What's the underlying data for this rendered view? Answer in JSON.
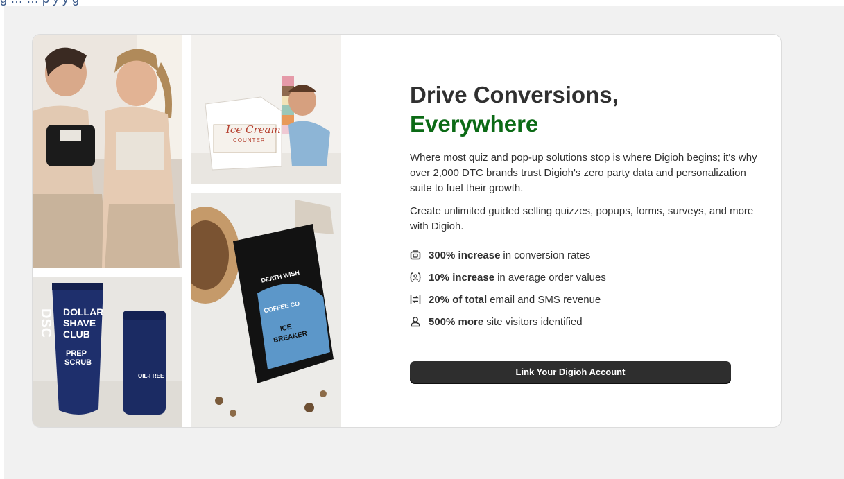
{
  "banner": {
    "text": "g … … p y y g"
  },
  "hero": {
    "title_line1": "Drive Conversions,",
    "title_line2": "Everywhere",
    "paragraph1": "Where most quiz and pop-up solutions stop is where Digioh begins; it's why over 2,000 DTC brands trust Digioh's zero party data and personalization suite to fuel their growth.",
    "paragraph2": "Create unlimited guided selling quizzes, popups, forms, surveys, and more with Digioh.",
    "stats": [
      {
        "icon": "conversion-icon",
        "value": "300% increase",
        "label": "in conversion rates"
      },
      {
        "icon": "order-value-icon",
        "value": "10% increase",
        "label": "in average order values"
      },
      {
        "icon": "revenue-icon",
        "value": "20% of total",
        "label": "email and SMS revenue"
      },
      {
        "icon": "user-icon",
        "value": "500% more",
        "label": "site visitors identified"
      }
    ],
    "cta_label": "Link Your Digioh Account"
  },
  "images": {
    "fitness": {
      "label": ""
    },
    "toy": {
      "label": "Ice Cream",
      "sublabel": "COUNTER"
    },
    "shave": {
      "brand_short": "DSC",
      "brand_line1": "DOLLAR",
      "brand_line2": "SHAVE",
      "brand_line3": "CLUB",
      "product1_line1": "PREP",
      "product1_line2": "SCRUB",
      "product2_line1": "OIL-FREE"
    },
    "coffee": {
      "brand_line1": "DEATH WISH",
      "brand_line2": "COFFEE CO",
      "product_line1": "ICE",
      "product_line2": "BREAKER"
    }
  },
  "colors": {
    "accent": "#0b6a15",
    "text": "#303030",
    "button": "#2e2e2e",
    "background": "#f1f1f1"
  }
}
